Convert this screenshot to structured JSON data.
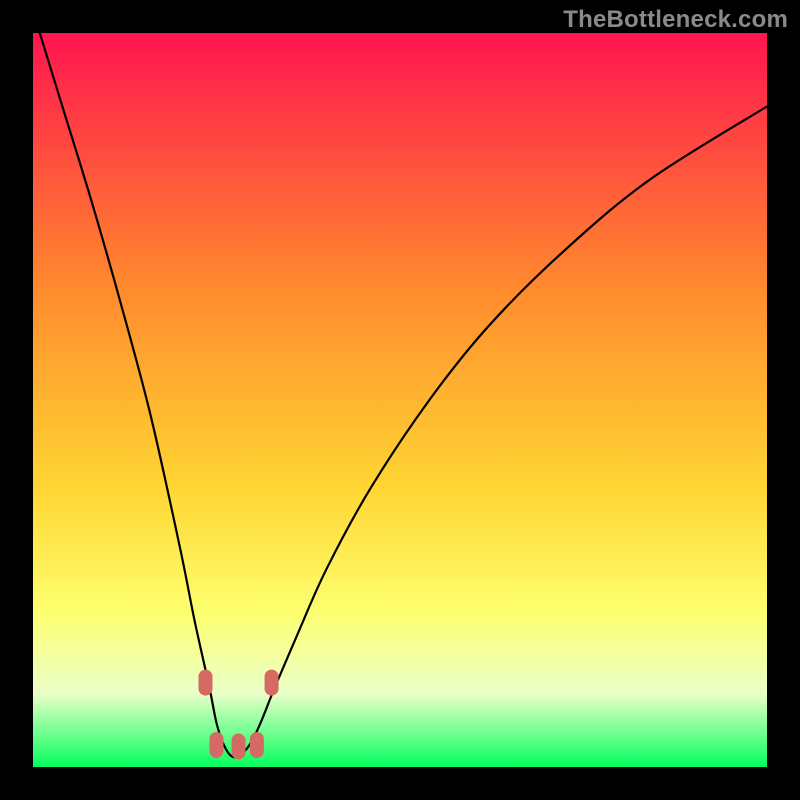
{
  "watermark": "TheBottleneck.com",
  "colors": {
    "frame": "#000000",
    "gradient_top": "#ff154f",
    "gradient_mid1": "#ff8b2d",
    "gradient_mid2": "#ffd633",
    "gradient_mid3": "#fdff70",
    "gradient_mid4": "#eaffc8",
    "gradient_bottom": "#05ff5e",
    "curve": "#000000",
    "marker": "#d46a63"
  },
  "chart_data": {
    "type": "line",
    "title": "",
    "xlabel": "",
    "ylabel": "",
    "xlim": [
      0,
      100
    ],
    "ylim": [
      0,
      100
    ],
    "series": [
      {
        "name": "bottleneck-curve",
        "x": [
          0,
          4,
          8,
          12,
          16,
          20,
          22,
          24,
          25,
          26,
          27,
          28,
          29.5,
          31,
          33,
          36,
          40,
          46,
          54,
          62,
          72,
          84,
          100
        ],
        "y": [
          103,
          90,
          77,
          63,
          48,
          30,
          20,
          11,
          6,
          3,
          1.5,
          1.5,
          3,
          6,
          11,
          18,
          27,
          38,
          50,
          60,
          70,
          80,
          90
        ]
      }
    ],
    "markers": {
      "name": "highlight-dots",
      "points": [
        {
          "x": 23.5,
          "y": 11.5
        },
        {
          "x": 25.0,
          "y": 3.0
        },
        {
          "x": 28.0,
          "y": 2.8
        },
        {
          "x": 30.5,
          "y": 3.0
        },
        {
          "x": 32.5,
          "y": 11.5
        }
      ]
    },
    "gradient_stops": [
      {
        "offset": 0.0,
        "color": "#ff154f"
      },
      {
        "offset": 0.35,
        "color": "#ff8b2d"
      },
      {
        "offset": 0.62,
        "color": "#ffd633"
      },
      {
        "offset": 0.79,
        "color": "#fdff70"
      },
      {
        "offset": 0.9,
        "color": "#eaffc8"
      },
      {
        "offset": 1.0,
        "color": "#05ff5e"
      }
    ]
  }
}
